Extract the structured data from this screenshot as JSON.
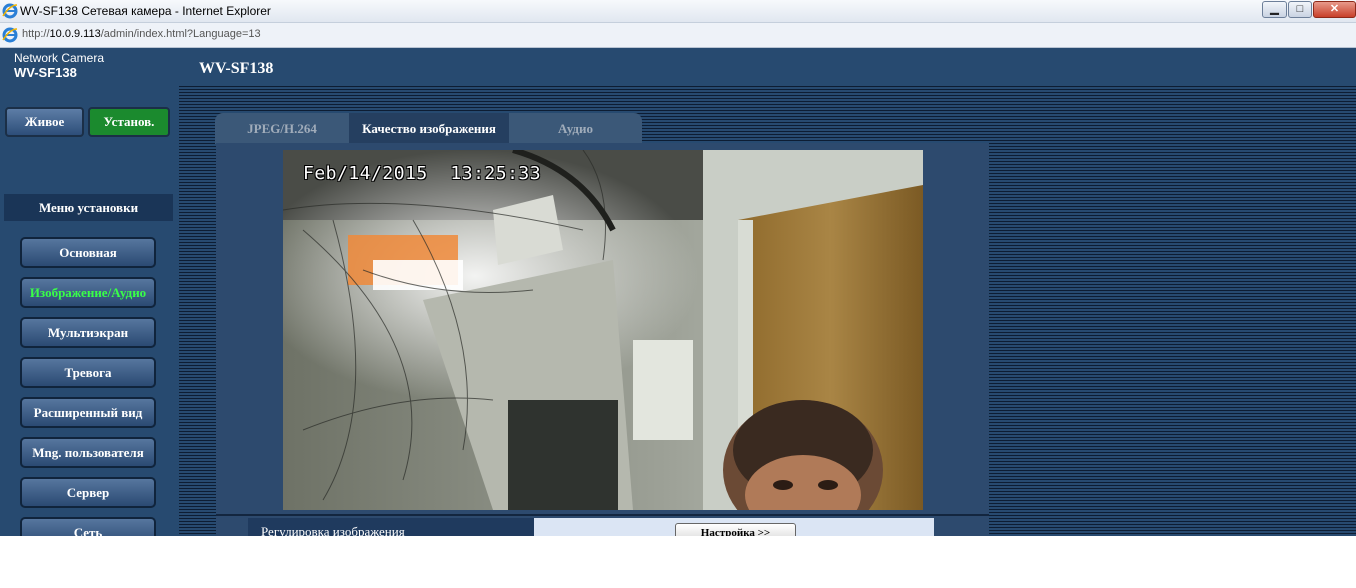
{
  "window": {
    "title": "WV-SF138 Сетевая камера - Internet Explorer",
    "url_prefix": "http://",
    "url_host": "10.0.9.113",
    "url_path": "/admin/index.html?Language=13",
    "minimize_symbol": "▁",
    "maximize_symbol": "□",
    "close_symbol": "✕"
  },
  "header": {
    "brand_line1": "Network Camera",
    "brand_model": "WV-SF138",
    "page_title": "WV-SF138"
  },
  "mode_buttons": {
    "live": "Живое",
    "setup": "Установ."
  },
  "sidebar": {
    "title": "Меню установки",
    "items": [
      {
        "label": "Основная"
      },
      {
        "label": "Изображение/Аудио",
        "active": true
      },
      {
        "label": "Мультиэкран"
      },
      {
        "label": "Тревога"
      },
      {
        "label": "Расширенный вид"
      },
      {
        "label": "Mng. пользователя"
      },
      {
        "label": "Сервер"
      },
      {
        "label": "Сеть"
      }
    ]
  },
  "tabs": [
    {
      "label": "JPEG/H.264",
      "active": false
    },
    {
      "label": "Качество изображения",
      "active": true
    },
    {
      "label": "Аудио",
      "active": false
    }
  ],
  "video": {
    "osd_date": "Feb/14/2015",
    "osd_time": "13:25:33"
  },
  "settings_row": {
    "label": "Регулировка изображения",
    "button": "Настройка >>"
  },
  "colors": {
    "header_bg": "#274a70",
    "active_green": "#1b8a2e",
    "active_text": "#39ff48"
  }
}
